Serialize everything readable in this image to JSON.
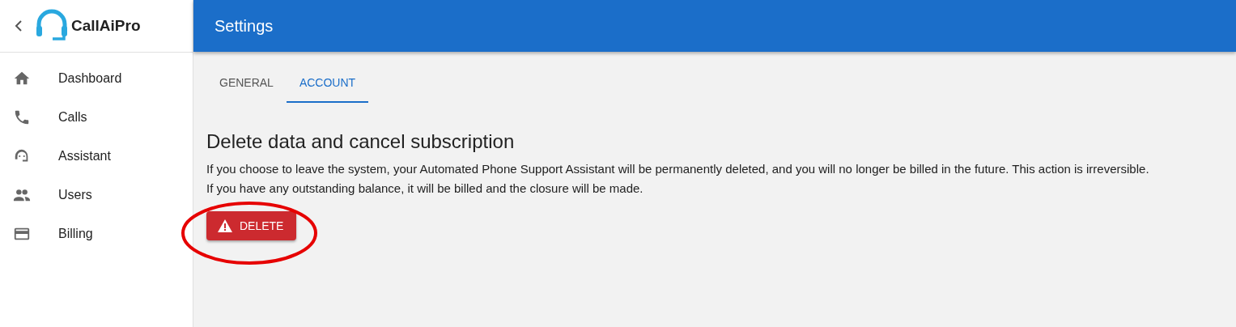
{
  "sidebar": {
    "logo": "CallAiPro",
    "items": [
      {
        "label": "Dashboard",
        "selected": false
      },
      {
        "label": "Calls",
        "selected": false
      },
      {
        "label": "Assistant",
        "selected": false
      },
      {
        "label": "Users",
        "selected": false
      },
      {
        "label": "Billing",
        "selected": false
      }
    ]
  },
  "app_bar": {
    "title": "Settings"
  },
  "tabs": [
    {
      "label": "GENERAL",
      "selected": false
    },
    {
      "label": "ACCOUNT",
      "selected": true
    }
  ],
  "section": {
    "title": "Delete data and cancel subscription",
    "lines": [
      "If you choose to leave the system, your Automated Phone Support Assistant will be permanently deleted, and you will no longer be billed in the future. This action is irreversible.",
      "If you have any outstanding balance, it will be billed and the closure will be made."
    ],
    "button": "DELETE"
  },
  "highlight": {
    "kind": "ellipse"
  }
}
